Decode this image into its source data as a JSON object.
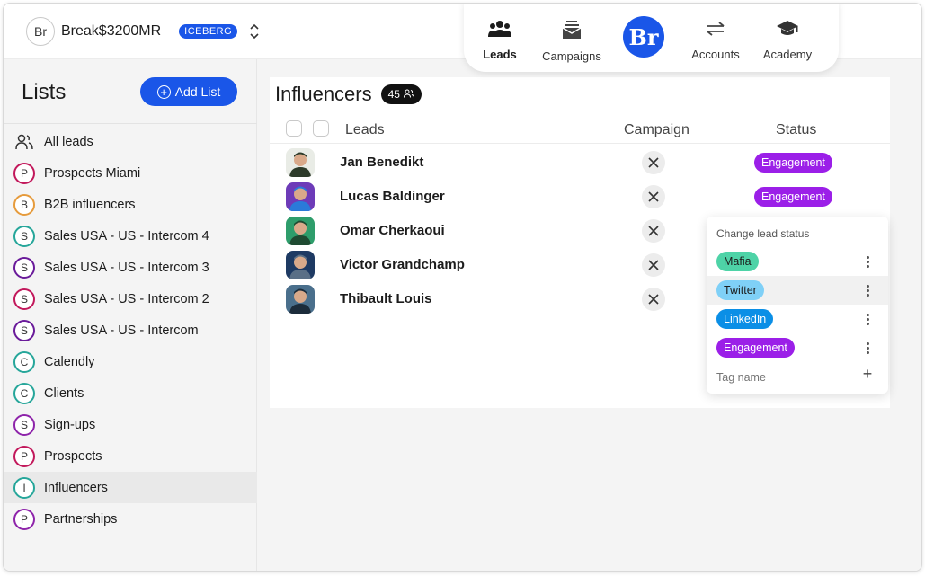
{
  "workspace": {
    "initials": "Br",
    "name": "Break$3200MR",
    "plan": "ICEBERG"
  },
  "nav": {
    "items": [
      {
        "label": "Leads",
        "icon": "users-icon",
        "active": true
      },
      {
        "label": "Campaigns",
        "icon": "inbox-icon",
        "active": false
      },
      {
        "label": "Accounts",
        "icon": "arrows-icon",
        "active": false
      },
      {
        "label": "Academy",
        "icon": "graduation-cap-icon",
        "active": false
      }
    ],
    "logo_text": "Br"
  },
  "sidebar": {
    "title": "Lists",
    "add_list_label": "Add List",
    "items": [
      {
        "label": "All leads",
        "letter": "",
        "color": "#333333",
        "icon": "users-icon"
      },
      {
        "label": "Prospects Miami",
        "letter": "P",
        "color": "#c2185b"
      },
      {
        "label": "B2B influencers",
        "letter": "B",
        "color": "#e69b3c"
      },
      {
        "label": "Sales USA - US - Intercom 4",
        "letter": "S",
        "color": "#26a69a"
      },
      {
        "label": "Sales USA - US - Intercom 3",
        "letter": "S",
        "color": "#6a1b9a"
      },
      {
        "label": "Sales USA - US - Intercom 2",
        "letter": "S",
        "color": "#c2185b"
      },
      {
        "label": "Sales USA - US - Intercom",
        "letter": "S",
        "color": "#6a1b9a"
      },
      {
        "label": "Calendly",
        "letter": "C",
        "color": "#26a69a"
      },
      {
        "label": "Clients",
        "letter": "C",
        "color": "#26a69a"
      },
      {
        "label": "Sign-ups",
        "letter": "S",
        "color": "#8e24aa"
      },
      {
        "label": "Prospects",
        "letter": "P",
        "color": "#c2185b"
      },
      {
        "label": "Influencers",
        "letter": "I",
        "color": "#26a69a",
        "active": true
      },
      {
        "label": "Partnerships",
        "letter": "P",
        "color": "#8e24aa"
      }
    ]
  },
  "main": {
    "title": "Influencers",
    "count": "45",
    "columns": {
      "leads": "Leads",
      "campaign": "Campaign",
      "status": "Status"
    },
    "rows": [
      {
        "name": "Jan Benedikt",
        "status": "Engagement",
        "avatar_colors": [
          "#e9ece6",
          "#2d3b2a"
        ]
      },
      {
        "name": "Lucas Baldinger",
        "status": "Engagement",
        "avatar_colors": [
          "#6d3bb8",
          "#2a7ad9"
        ]
      },
      {
        "name": "Omar Cherkaoui",
        "status": "",
        "avatar_colors": [
          "#2e9d6b",
          "#1f4b32"
        ]
      },
      {
        "name": "Victor Grandchamp",
        "status": "",
        "avatar_colors": [
          "#1e3a63",
          "#5a6f86"
        ]
      },
      {
        "name": "Thibault Louis",
        "status": "",
        "avatar_colors": [
          "#4a6f8c",
          "#1c2c3b"
        ]
      }
    ],
    "status_color": "#9b1fe8"
  },
  "dropdown": {
    "title": "Change lead status",
    "tags": [
      {
        "label": "Mafia",
        "bg": "#4ed3a7",
        "fg": "#1c1c1c"
      },
      {
        "label": "Twitter",
        "bg": "#7fd0f7",
        "fg": "#1c1c1c"
      },
      {
        "label": "LinkedIn",
        "bg": "#0b8fe6",
        "fg": "#ffffff"
      },
      {
        "label": "Engagement",
        "bg": "#9b1fe8",
        "fg": "#ffffff"
      }
    ],
    "input_placeholder": "Tag name"
  }
}
